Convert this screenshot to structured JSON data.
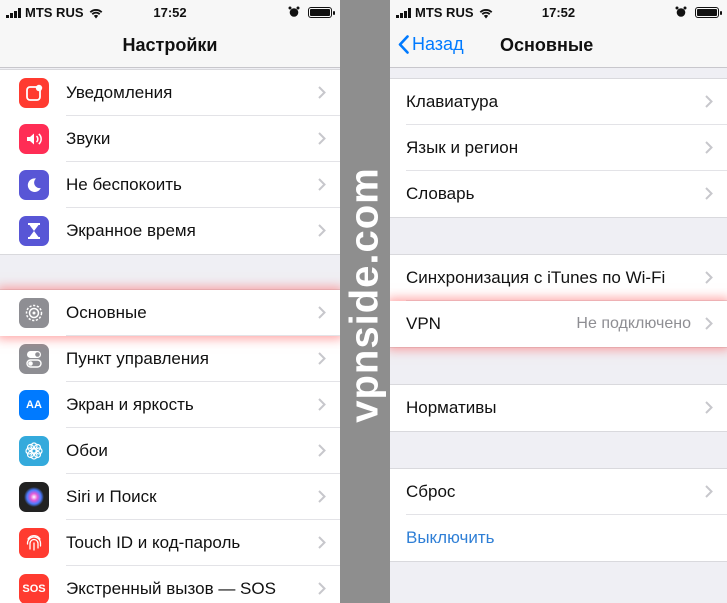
{
  "status_left": {
    "carrier": "MTS RUS",
    "time": "17:52"
  },
  "status_right": {
    "carrier": "MTS RUS",
    "time": "17:52"
  },
  "left_screen": {
    "title": "Настройки",
    "groups": [
      {
        "items": [
          {
            "label": "Уведомления",
            "icon": "notifications-icon",
            "color": "#ff3b30"
          },
          {
            "label": "Звуки",
            "icon": "sounds-icon",
            "color": "#ff2d55"
          },
          {
            "label": "Не беспокоить",
            "icon": "moon-icon",
            "color": "#5856d6"
          },
          {
            "label": "Экранное время",
            "icon": "hourglass-icon",
            "color": "#5856d6"
          }
        ]
      },
      {
        "items": [
          {
            "label": "Основные",
            "icon": "gear-icon",
            "color": "#8e8e93",
            "highlighted": true
          },
          {
            "label": "Пункт управления",
            "icon": "toggles-icon",
            "color": "#8e8e93"
          },
          {
            "label": "Экран и яркость",
            "icon": "text-size-icon",
            "color": "#007aff",
            "icon_text": "AA"
          },
          {
            "label": "Обои",
            "icon": "flower-icon",
            "color": "#34aadc"
          },
          {
            "label": "Siri и Поиск",
            "icon": "siri-icon",
            "color": "#222222"
          },
          {
            "label": "Touch ID и код-пароль",
            "icon": "fingerprint-icon",
            "color": "#ff3b30"
          },
          {
            "label": "Экстренный вызов — SOS",
            "icon": "sos-icon",
            "color": "#ff3b30",
            "icon_text": "SOS"
          }
        ]
      }
    ]
  },
  "right_screen": {
    "back_label": "Назад",
    "title": "Основные",
    "rows": {
      "keyboard": "Клавиатура",
      "language": "Язык и регион",
      "dictionary": "Словарь",
      "itunes_sync": "Синхронизация с iTunes по Wi-Fi",
      "vpn": "VPN",
      "vpn_status": "Не подключено",
      "regulatory": "Нормативы",
      "reset": "Сброс",
      "shutdown": "Выключить"
    }
  },
  "watermark": "vpnside.com",
  "colors": {
    "accent": "#007aff",
    "highlight_glow": "#ff5f5f",
    "shutdown": "#2f7fd6"
  }
}
